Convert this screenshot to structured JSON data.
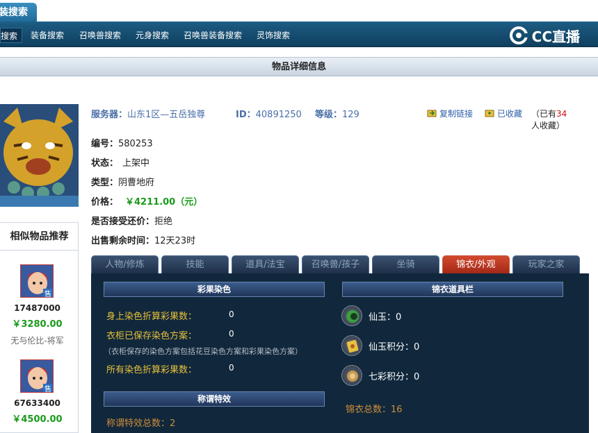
{
  "top_tab": {
    "label": "装搜索"
  },
  "nav": {
    "items": [
      "搜索",
      "装备搜索",
      "召唤兽搜索",
      "元身搜索",
      "召唤兽装备搜索",
      "灵饰搜索"
    ],
    "logo_text": "CC直播"
  },
  "page_title": "物品详细信息",
  "info": {
    "server_label": "服务器：",
    "server_value": "山东1区—五岳独尊",
    "id_label": "ID：",
    "id_value": "40891250",
    "level_label": "等级：",
    "level_value": "129",
    "copy_link": "复制链接",
    "fav_link": "已收藏",
    "fav_prefix": "（已有",
    "fav_count": "34",
    "fav_suffix": "人收藏）",
    "number_label": "编号：",
    "number_value": "580253",
    "status_label": "状态：",
    "status_value": "上架中",
    "type_label": "类型：",
    "type_value": "阴曹地府",
    "price_label": "价格：",
    "price_value": "￥4211.00（元）",
    "counter_label": "是否接受还价：",
    "counter_value": "拒绝",
    "remaining_label": "出售剩余时间：",
    "remaining_value": "12天23时"
  },
  "tabs": [
    "人物/修炼",
    "技能",
    "道具/法宝",
    "召唤兽/孩子",
    "坐骑",
    "锦衣/外观",
    "玩家之家"
  ],
  "active_tab": 5,
  "dye": {
    "header": "彩果染色",
    "body_label": "身上染色折算彩果数：",
    "body_value": "0",
    "wardrobe_label": "衣柜已保存染色方案：",
    "wardrobe_value": "0",
    "note": "（衣柜保存的染色方案包括花豆染色方案和彩果染色方案）",
    "total_label": "所有染色折算彩果数：",
    "total_value": "0"
  },
  "effect": {
    "header": "称谓特效",
    "count_label": "称谓特效总数：",
    "count_value": "2"
  },
  "jinyi": {
    "header": "锦衣道具栏",
    "items": [
      {
        "label": "仙玉：",
        "value": "0",
        "icon": "jade-icon"
      },
      {
        "label": "仙玉积分：",
        "value": "0",
        "icon": "jade-points-icon"
      },
      {
        "label": "七彩积分：",
        "value": "0",
        "icon": "rainbow-points-icon"
      }
    ],
    "total_label": "锦衣总数：",
    "total_value": "16"
  },
  "sidebar": {
    "title": "相似物品推荐",
    "items": [
      {
        "id": "17487000",
        "price": "￥3280.00",
        "name": "无与伦比-将军",
        "badge": "售"
      },
      {
        "id": "67633400",
        "price": "￥4500.00",
        "name": "",
        "badge": "售"
      }
    ]
  },
  "colors": {
    "price_green": "#1a9a1a",
    "label_yellow": "#e8c03a",
    "active_tab": "#b83421",
    "panel_bg": "#11283c"
  }
}
